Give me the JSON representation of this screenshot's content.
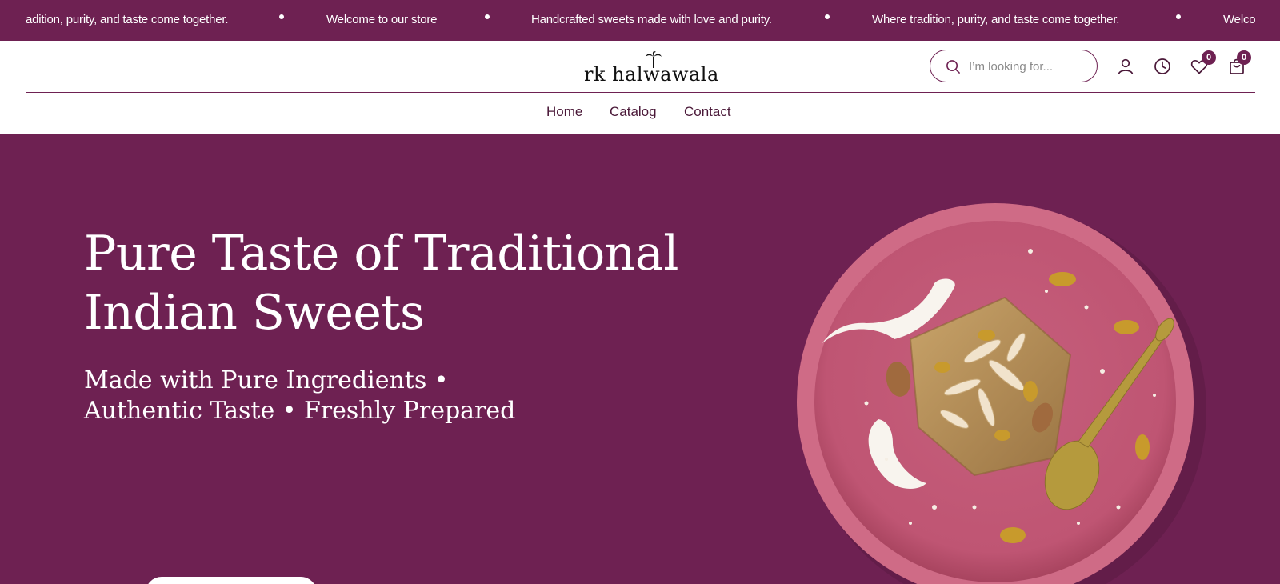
{
  "announcement_bar": {
    "messages": [
      "adition, purity, and taste come together.",
      "Welcome to our store",
      "Handcrafted sweets made with love and purity.",
      "Where tradition, purity, and taste come together.",
      "Welco"
    ]
  },
  "header": {
    "logo_text": "rk halwawala",
    "search": {
      "placeholder": "I’m looking for..."
    },
    "wishlist_count": "0",
    "cart_count": "0",
    "icons": [
      "search-icon",
      "account-icon",
      "recent-history-icon",
      "wishlist-heart-icon",
      "cart-bag-icon"
    ]
  },
  "nav": {
    "items": [
      {
        "label": "Home"
      },
      {
        "label": "Catalog"
      },
      {
        "label": "Contact"
      }
    ]
  },
  "hero": {
    "title_line1": "Pure Taste of Traditional",
    "title_line2": "Indian Sweets",
    "subtitle_line1": "Made with Pure Ingredients •",
    "subtitle_line2": "Authentic Taste • Freshly Prepared",
    "image": "plate-of-barfi-with-almonds-coconut-spoon"
  },
  "colors": {
    "brand": "#6e2152",
    "plate": "#c45a78"
  }
}
